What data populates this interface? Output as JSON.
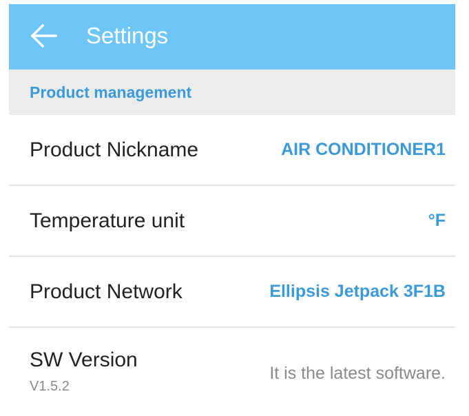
{
  "header": {
    "title": "Settings",
    "back_icon": "arrow-left-icon",
    "background_color": "#6ec6f8"
  },
  "section": {
    "title": "Product management",
    "accent_color": "#3a9ad9"
  },
  "rows": [
    {
      "label": "Product Nickname",
      "value": "AIR CONDITIONER1"
    },
    {
      "label": "Temperature unit",
      "value": "°F"
    },
    {
      "label": "Product Network",
      "value": "Ellipsis Jetpack 3F1B"
    }
  ],
  "sw": {
    "label": "SW Version",
    "version": "V1.5.2",
    "status": "It is the latest software."
  }
}
